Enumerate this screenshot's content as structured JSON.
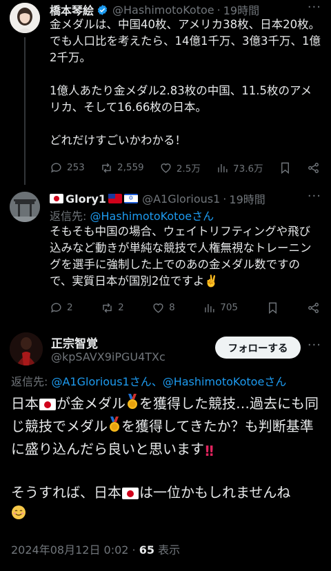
{
  "tweet1": {
    "name": "橋本琴絵",
    "handle": "@HashimotoKotoe",
    "time": "19時間",
    "text": "金メダルは、中国40枚、アメリカ38枚、日本20枚。でも人口比を考えたら、14億1千万、3億3千万、1億2千万。\n\n1億人あたり金メダル2.83枚の中国、11.5枚のアメリカ、そして16.66枚の日本。\n\nどれだけすごいかわかる！",
    "replies": "253",
    "reposts": "2,559",
    "likes": "2.5万",
    "views": "73.6万"
  },
  "tweet2": {
    "name": "Glory1",
    "handle": "@A1Glorious1",
    "time": "19時間",
    "reply_prefix": "返信先: ",
    "reply_link": "@HashimotoKotoeさん",
    "text": "そもそも中国の場合、ウェイトリフティングや飛び込みなど動きが単純な競技で人権無視なトレーニングを選手に強制した上でのあの金メダル数ですので、実質日本が国別2位ですよ✌️",
    "replies": "2",
    "reposts": "2",
    "likes": "8",
    "views": "705"
  },
  "tweet3": {
    "name": "正宗智覚",
    "handle": "@kpSAVX9iPGU4TXc",
    "follow_label": "フォローする",
    "reply_prefix": "返信先: ",
    "reply_link": "@A1Glorious1さん、@HashimotoKotoeさん",
    "text_part1": "日本",
    "text_part2": "が金メダル",
    "text_part3": "を獲得した競技…過去にも同じ競技でメダル",
    "text_part4": "を獲得してきたか？も判断基準に盛り込んだら良いと思います",
    "text_part5": "\n\nそうすれば、日本",
    "text_part6": "は一位かもしれませんね",
    "date": "2024年08月12日 0:02",
    "views_count": "65",
    "views_label": "表示"
  }
}
